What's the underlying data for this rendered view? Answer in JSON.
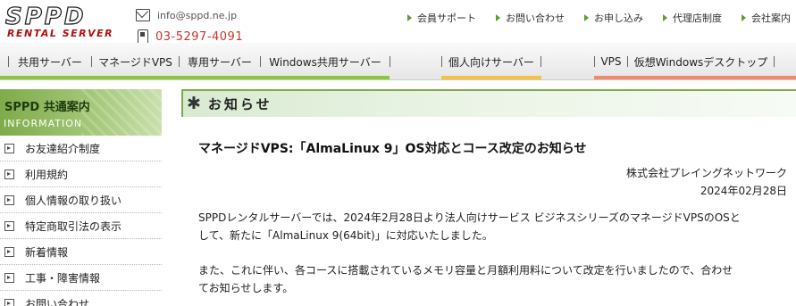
{
  "header": {
    "logo_main": "SPPD",
    "logo_sub": "RENTAL SERVER",
    "email": "info@sppd.ne.jp",
    "tel": "03-5297-4091",
    "links": [
      "会員サポート",
      "お問い合わせ",
      "お申し込み",
      "代理店制度",
      "会社案内"
    ]
  },
  "mainnav": {
    "items": [
      "共用サーバー",
      "マネージドVPS",
      "専用サーバー",
      "Windows共用サーバー",
      "個人向けサーバー",
      "VPS",
      "仮想Windowsデスクトップ"
    ],
    "bar_colors": [
      "#8cc63f",
      "#f5c242",
      "#f08a6a"
    ]
  },
  "sidebar": {
    "title": "SPPD 共通案内",
    "subtitle": "INFORMATION",
    "items": [
      "お友達紹介制度",
      "利用規約",
      "個人情報の取り扱い",
      "特定商取引法の表示",
      "新着情報",
      "工事・障害情報",
      "お問い合わせ"
    ]
  },
  "content": {
    "section_title": "お知らせ",
    "news_title": "マネージドVPS:「AlmaLinux 9」OS対応とコース改定のお知らせ",
    "company": "株式会社プレイングネットワーク",
    "date": "2024年02月28日",
    "para1_line1": "SPPDレンタルサーバーでは、2024年2月28日より法人向けサービス ビジネスシリーズのマネージドVPSのOSと",
    "para1_line2": "して、新たに「AlmaLinux 9(64bit)」に対応いたしました。",
    "para2_line1": "また、これに伴い、各コースに搭載されているメモリ容量と月額利用料について改定を行いましたので、合わせ",
    "para2_line2": "てお知らせします。"
  }
}
